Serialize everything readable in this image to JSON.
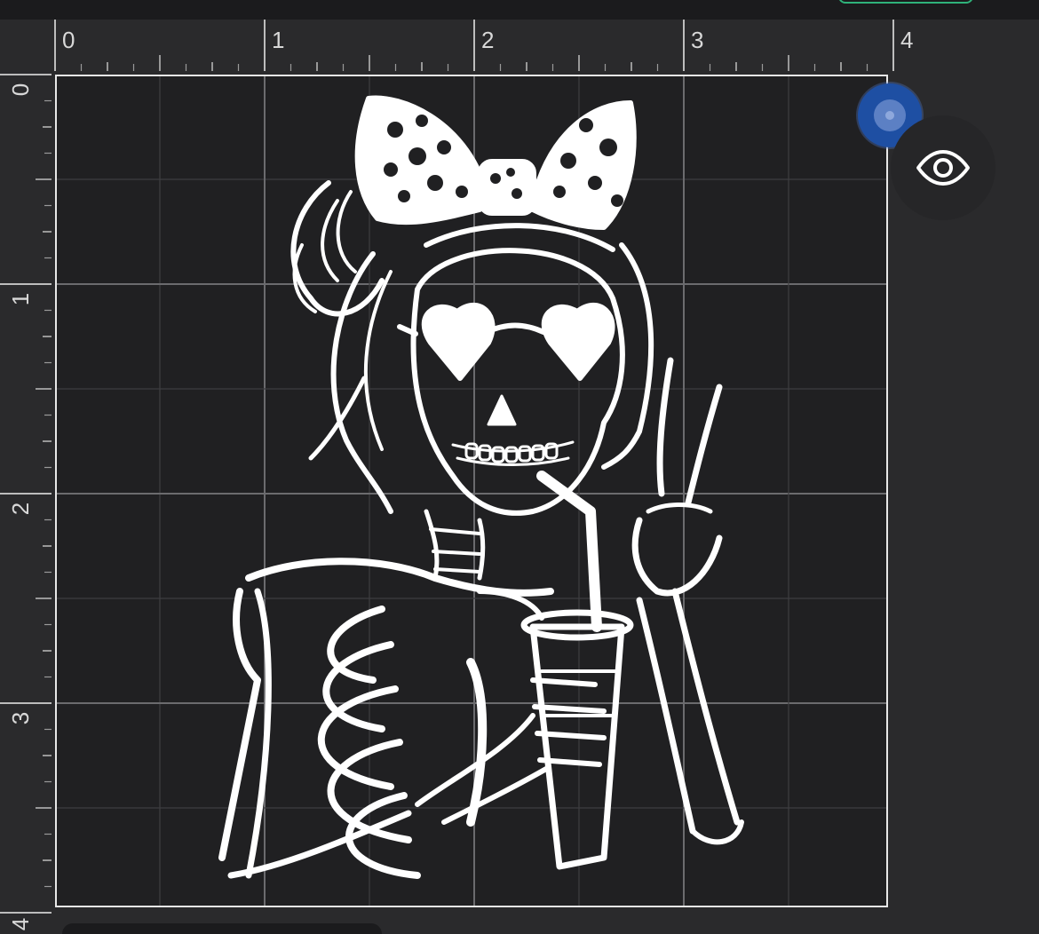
{
  "rulers": {
    "top_labels": [
      "0",
      "1",
      "2",
      "3",
      "4"
    ],
    "left_labels": [
      "0",
      "1",
      "2",
      "3",
      "4"
    ]
  },
  "colors": {
    "accent_green": "#2fb27a",
    "handle_blue": "#1e4fa3",
    "mat_border": "#e8e8e8"
  },
  "icons": {
    "visibility": "eye-icon",
    "rotate_handle": "rotate-handle-icon"
  }
}
